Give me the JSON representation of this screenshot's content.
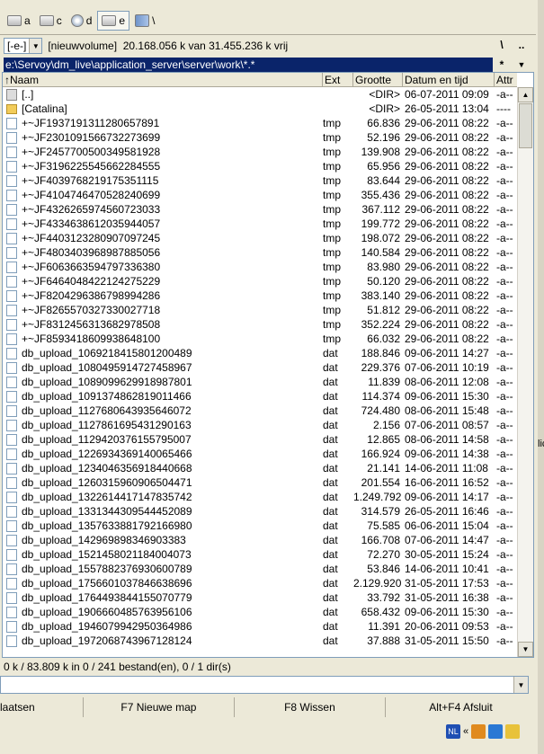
{
  "drives": [
    {
      "label": "a",
      "selected": false
    },
    {
      "label": "c",
      "selected": false
    },
    {
      "label": "d",
      "selected": false
    },
    {
      "label": "e",
      "selected": true
    },
    {
      "label": "\\",
      "selected": false
    }
  ],
  "volume": {
    "drive_combo": "[-e-]",
    "info": "[nieuwvolume]  20.168.056 k van 31.455.236 k vrij",
    "root_btn": "\\",
    "up_btn": ".."
  },
  "path": {
    "text": "e:\\Servoy\\dm_live\\application_server\\server\\work\\*.*",
    "history_star": "*"
  },
  "columns": {
    "name": "↑Naam",
    "ext": "Ext",
    "size": "Grootte",
    "date": "Datum en tijd",
    "attr": "Attr"
  },
  "files": [
    {
      "name": "[..]",
      "ext": "",
      "size": "<DIR>",
      "date": "06-07-2011 09:09",
      "attr": "-a--",
      "type": "up"
    },
    {
      "name": "[Catalina]",
      "ext": "",
      "size": "<DIR>",
      "date": "26-05-2011 13:04",
      "attr": "----",
      "type": "folder"
    },
    {
      "name": "+~JF1937191311280657891",
      "ext": "tmp",
      "size": "66.836",
      "date": "29-06-2011 08:22",
      "attr": "-a--",
      "type": "file"
    },
    {
      "name": "+~JF2301091566732273699",
      "ext": "tmp",
      "size": "52.196",
      "date": "29-06-2011 08:22",
      "attr": "-a--",
      "type": "file"
    },
    {
      "name": "+~JF2457700500349581928",
      "ext": "tmp",
      "size": "139.908",
      "date": "29-06-2011 08:22",
      "attr": "-a--",
      "type": "file"
    },
    {
      "name": "+~JF3196225545662284555",
      "ext": "tmp",
      "size": "65.956",
      "date": "29-06-2011 08:22",
      "attr": "-a--",
      "type": "file"
    },
    {
      "name": "+~JF4039768219175351115",
      "ext": "tmp",
      "size": "83.644",
      "date": "29-06-2011 08:22",
      "attr": "-a--",
      "type": "file"
    },
    {
      "name": "+~JF4104746470528240699",
      "ext": "tmp",
      "size": "355.436",
      "date": "29-06-2011 08:22",
      "attr": "-a--",
      "type": "file"
    },
    {
      "name": "+~JF4326265974560723033",
      "ext": "tmp",
      "size": "367.112",
      "date": "29-06-2011 08:22",
      "attr": "-a--",
      "type": "file"
    },
    {
      "name": "+~JF4334638612035944057",
      "ext": "tmp",
      "size": "199.772",
      "date": "29-06-2011 08:22",
      "attr": "-a--",
      "type": "file"
    },
    {
      "name": "+~JF4403123280907097245",
      "ext": "tmp",
      "size": "198.072",
      "date": "29-06-2011 08:22",
      "attr": "-a--",
      "type": "file"
    },
    {
      "name": "+~JF4803403968987885056",
      "ext": "tmp",
      "size": "140.584",
      "date": "29-06-2011 08:22",
      "attr": "-a--",
      "type": "file"
    },
    {
      "name": "+~JF6063663594797336380",
      "ext": "tmp",
      "size": "83.980",
      "date": "29-06-2011 08:22",
      "attr": "-a--",
      "type": "file"
    },
    {
      "name": "+~JF6464048422124275229",
      "ext": "tmp",
      "size": "50.120",
      "date": "29-06-2011 08:22",
      "attr": "-a--",
      "type": "file"
    },
    {
      "name": "+~JF8204296386798994286",
      "ext": "tmp",
      "size": "383.140",
      "date": "29-06-2011 08:22",
      "attr": "-a--",
      "type": "file"
    },
    {
      "name": "+~JF8265570327330027718",
      "ext": "tmp",
      "size": "51.812",
      "date": "29-06-2011 08:22",
      "attr": "-a--",
      "type": "file"
    },
    {
      "name": "+~JF8312456313682978508",
      "ext": "tmp",
      "size": "352.224",
      "date": "29-06-2011 08:22",
      "attr": "-a--",
      "type": "file"
    },
    {
      "name": "+~JF8593418609938648100",
      "ext": "tmp",
      "size": "66.032",
      "date": "29-06-2011 08:22",
      "attr": "-a--",
      "type": "file"
    },
    {
      "name": "db_upload_1069218415801200489",
      "ext": "dat",
      "size": "188.846",
      "date": "09-06-2011 14:27",
      "attr": "-a--",
      "type": "file"
    },
    {
      "name": "db_upload_1080495914727458967",
      "ext": "dat",
      "size": "229.376",
      "date": "07-06-2011 10:19",
      "attr": "-a--",
      "type": "file"
    },
    {
      "name": "db_upload_1089099629918987801",
      "ext": "dat",
      "size": "11.839",
      "date": "08-06-2011 12:08",
      "attr": "-a--",
      "type": "file"
    },
    {
      "name": "db_upload_1091374862819011466",
      "ext": "dat",
      "size": "114.374",
      "date": "09-06-2011 15:30",
      "attr": "-a--",
      "type": "file"
    },
    {
      "name": "db_upload_1127680643935646072",
      "ext": "dat",
      "size": "724.480",
      "date": "08-06-2011 15:48",
      "attr": "-a--",
      "type": "file"
    },
    {
      "name": "db_upload_1127861695431290163",
      "ext": "dat",
      "size": "2.156",
      "date": "07-06-2011 08:57",
      "attr": "-a--",
      "type": "file"
    },
    {
      "name": "db_upload_1129420376155795007",
      "ext": "dat",
      "size": "12.865",
      "date": "08-06-2011 14:58",
      "attr": "-a--",
      "type": "file"
    },
    {
      "name": "db_upload_1226934369140065466",
      "ext": "dat",
      "size": "166.924",
      "date": "09-06-2011 14:38",
      "attr": "-a--",
      "type": "file"
    },
    {
      "name": "db_upload_1234046356918440668",
      "ext": "dat",
      "size": "21.141",
      "date": "14-06-2011 11:08",
      "attr": "-a--",
      "type": "file"
    },
    {
      "name": "db_upload_1260315960906504471",
      "ext": "dat",
      "size": "201.554",
      "date": "16-06-2011 16:52",
      "attr": "-a--",
      "type": "file"
    },
    {
      "name": "db_upload_1322614417147835742",
      "ext": "dat",
      "size": "1.249.792",
      "date": "09-06-2011 14:17",
      "attr": "-a--",
      "type": "file"
    },
    {
      "name": "db_upload_1331344309544452089",
      "ext": "dat",
      "size": "314.579",
      "date": "26-05-2011 16:46",
      "attr": "-a--",
      "type": "file"
    },
    {
      "name": "db_upload_1357633881792166980",
      "ext": "dat",
      "size": "75.585",
      "date": "06-06-2011 15:04",
      "attr": "-a--",
      "type": "file"
    },
    {
      "name": "db_upload_142969898346903383",
      "ext": "dat",
      "size": "166.708",
      "date": "07-06-2011 14:47",
      "attr": "-a--",
      "type": "file"
    },
    {
      "name": "db_upload_1521458021184004073",
      "ext": "dat",
      "size": "72.270",
      "date": "30-05-2011 15:24",
      "attr": "-a--",
      "type": "file"
    },
    {
      "name": "db_upload_1557882376930600789",
      "ext": "dat",
      "size": "53.846",
      "date": "14-06-2011 10:41",
      "attr": "-a--",
      "type": "file"
    },
    {
      "name": "db_upload_1756601037846638696",
      "ext": "dat",
      "size": "2.129.920",
      "date": "31-05-2011 17:53",
      "attr": "-a--",
      "type": "file"
    },
    {
      "name": "db_upload_1764493844155070779",
      "ext": "dat",
      "size": "33.792",
      "date": "31-05-2011 16:38",
      "attr": "-a--",
      "type": "file"
    },
    {
      "name": "db_upload_1906660485763956106",
      "ext": "dat",
      "size": "658.432",
      "date": "09-06-2011 15:30",
      "attr": "-a--",
      "type": "file"
    },
    {
      "name": "db_upload_1946079942950364986",
      "ext": "dat",
      "size": "11.391",
      "date": "20-06-2011 09:53",
      "attr": "-a--",
      "type": "file"
    },
    {
      "name": "db_upload_1972068743967128124",
      "ext": "dat",
      "size": "37.888",
      "date": "31-05-2011 15:50",
      "attr": "-a--",
      "type": "file"
    }
  ],
  "status": "0 k / 83.809 k in 0 / 241 bestand(en), 0 / 1 dir(s)",
  "fkeys": [
    "laatsen",
    "F7 Nieuwe map",
    "F8 Wissen",
    "Alt+F4 Afsluit"
  ],
  "tray": {
    "lang": "NL",
    "chevron": "«"
  },
  "edge_label": "lic"
}
